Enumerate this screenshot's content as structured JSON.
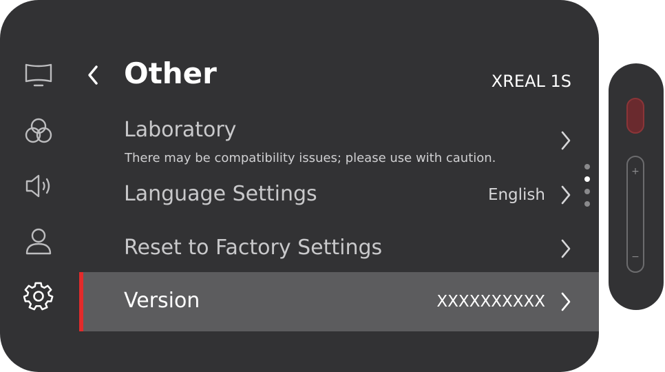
{
  "sidebar": {
    "items": [
      {
        "icon": "display-icon",
        "label": "Display"
      },
      {
        "icon": "color-circles-icon",
        "label": "Color"
      },
      {
        "icon": "speaker-icon",
        "label": "Sound"
      },
      {
        "icon": "user-icon",
        "label": "Account"
      },
      {
        "icon": "gear-icon",
        "label": "Settings",
        "active": true
      }
    ]
  },
  "header": {
    "title": "Other",
    "device_name": "XREAL 1S"
  },
  "menu": {
    "laboratory": {
      "label": "Laboratory",
      "subtitle": "There may be compatibility issues; please use with caution."
    },
    "language": {
      "label": "Language Settings",
      "value": "English"
    },
    "reset": {
      "label": "Reset to Factory Settings"
    },
    "version": {
      "label": "Version",
      "value": "XXXXXXXXXX"
    }
  },
  "pager": {
    "count": 4,
    "active_index": 1
  },
  "remote": {
    "plus_label": "+",
    "minus_label": "−"
  },
  "colors": {
    "panel_bg": "#323234",
    "selected_bg": "#5c5c5e",
    "accent": "#e32b2b",
    "text": "#ffffff",
    "muted_text": "#c9c9cb"
  }
}
